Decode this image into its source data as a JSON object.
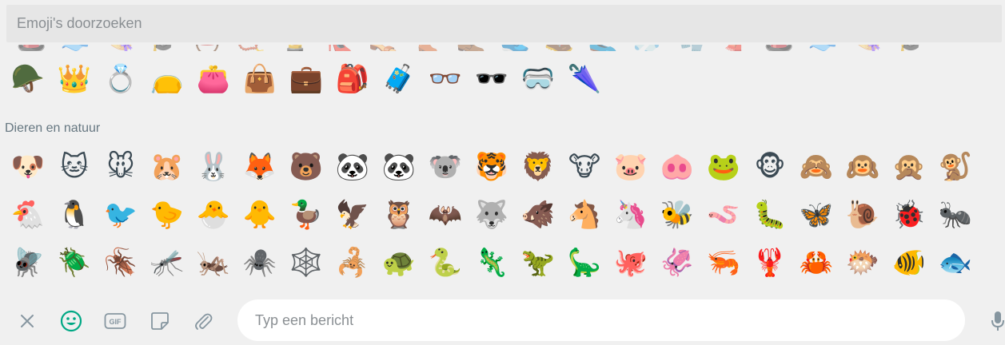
{
  "search": {
    "placeholder": "Emoji's doorzoeken"
  },
  "objects_row": [
    "🪖",
    "👑",
    "💍",
    "👝",
    "👛",
    "👜",
    "💼",
    "🎒",
    "🧳",
    "👓",
    "🕶️",
    "🥽",
    "🌂"
  ],
  "clipped_row": [
    "🎩",
    "🧢",
    "👒",
    "🎓",
    "⛑️",
    "📿",
    "💄",
    "👠",
    "👡",
    "👢",
    "👞",
    "👟",
    "🥾",
    "🥿",
    "🧦",
    "🧤",
    "🧣",
    "🎩",
    "🧢",
    "👒",
    "🎓"
  ],
  "category": {
    "animals_label": "Dieren en natuur"
  },
  "animals_row1": [
    "🐶",
    "🐱",
    "🐭",
    "🐹",
    "🐰",
    "🦊",
    "🐻",
    "🐼",
    "🐼",
    "🐨",
    "🐯",
    "🦁",
    "🐮",
    "🐷",
    "🐽",
    "🐸",
    "🐵",
    "🙈",
    "🙉",
    "🙊",
    "🐒"
  ],
  "animals_row2": [
    "🐔",
    "🐧",
    "🐦",
    "🐤",
    "🐣",
    "🐥",
    "🦆",
    "🦅",
    "🦉",
    "🦇",
    "🐺",
    "🐗",
    "🐴",
    "🦄",
    "🐝",
    "🪱",
    "🐛",
    "🦋",
    "🐌",
    "🐞",
    "🐜"
  ],
  "animals_row3": [
    "🪰",
    "🪲",
    "🪳",
    "🦟",
    "🦗",
    "🕷️",
    "🕸️",
    "🦂",
    "🐢",
    "🐍",
    "🦎",
    "🦖",
    "🦕",
    "🐙",
    "🦑",
    "🦐",
    "🦞",
    "🦀",
    "🐡",
    "🐠",
    "🐟"
  ],
  "composer": {
    "placeholder": "Typ een bericht",
    "gif_label": "GIF"
  },
  "icons": {
    "close": "close-icon",
    "emoji": "smiley-icon",
    "gif": "gif-icon",
    "sticker": "sticker-icon",
    "attach": "paperclip-icon",
    "mic": "microphone-icon"
  },
  "colors": {
    "accent": "#00a884",
    "icon": "#8696a0",
    "background": "#f0f0f0"
  }
}
